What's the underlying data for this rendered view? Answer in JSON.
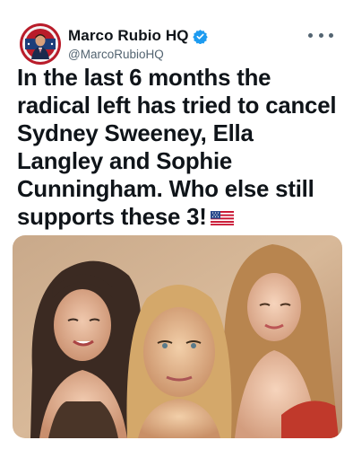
{
  "author": {
    "display_name": "Marco Rubio HQ",
    "handle": "@MarcoRubioHQ",
    "verified_icon": "verified-badge-icon",
    "avatar_icon": "avatar"
  },
  "tweet": {
    "text": "In the last 6 months the radical left has tried to cancel Sydney Sweeney, Ella Langley and Sophie Cunningham. Who else still supports these 3!",
    "emoji_icon": "us-flag-icon",
    "more_icon": "more-options-icon"
  },
  "media": {
    "type": "photo of three women"
  },
  "colors": {
    "verified_blue": "#1d9bf0",
    "text_primary": "#0f1419",
    "text_secondary": "#536471"
  }
}
